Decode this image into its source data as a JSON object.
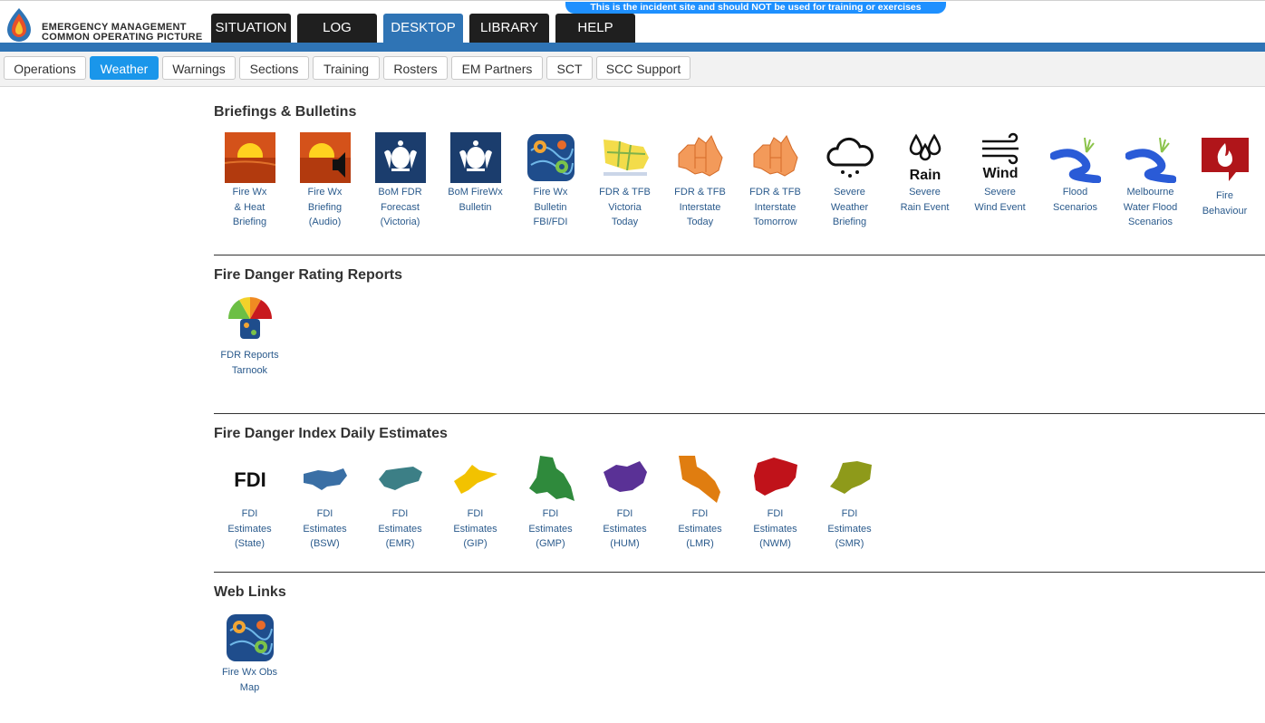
{
  "header": {
    "logo_line1": "EMERGENCY MANAGEMENT",
    "logo_line2": "COMMON OPERATING PICTURE",
    "banner": "This is the incident site and should NOT be used for training or exercises",
    "tabs": [
      {
        "label": "SITUATION"
      },
      {
        "label": "LOG"
      },
      {
        "label": "DESKTOP"
      },
      {
        "label": "LIBRARY"
      },
      {
        "label": "HELP"
      }
    ],
    "active_tab": "DESKTOP"
  },
  "subnav": {
    "items": [
      {
        "label": "Operations"
      },
      {
        "label": "Weather"
      },
      {
        "label": "Warnings"
      },
      {
        "label": "Sections"
      },
      {
        "label": "Training"
      },
      {
        "label": "Rosters"
      },
      {
        "label": "EM Partners"
      },
      {
        "label": "SCT"
      },
      {
        "label": "SCC Support"
      }
    ],
    "active": "Weather"
  },
  "sections": [
    {
      "title": "Briefings & Bulletins",
      "tiles": [
        {
          "icon": "sunset-icon",
          "lines": [
            "Fire Wx",
            "& Heat",
            "Briefing"
          ]
        },
        {
          "icon": "sunset-audio-icon",
          "lines": [
            "Fire Wx",
            "Briefing",
            "(Audio)"
          ]
        },
        {
          "icon": "coat-of-arms-icon",
          "lines": [
            "BoM FDR",
            "Forecast",
            "(Victoria)"
          ]
        },
        {
          "icon": "coat-of-arms-icon",
          "lines": [
            "BoM FireWx",
            "Bulletin"
          ]
        },
        {
          "icon": "aboriginal-art-icon",
          "lines": [
            "Fire Wx",
            "Bulletin",
            "FBI/FDI"
          ]
        },
        {
          "icon": "victoria-map-icon",
          "lines": [
            "FDR & TFB",
            "Victoria",
            "Today"
          ]
        },
        {
          "icon": "australia-map-icon",
          "lines": [
            "FDR & TFB",
            "Interstate",
            "Today"
          ]
        },
        {
          "icon": "australia-map-icon",
          "lines": [
            "FDR & TFB",
            "Interstate",
            "Tomorrow"
          ]
        },
        {
          "icon": "cloud-icon",
          "lines": [
            "Severe",
            "Weather",
            "Briefing"
          ]
        },
        {
          "icon": "rain-icon",
          "lines": [
            "Severe",
            "Rain Event"
          ],
          "icon_text": "Rain"
        },
        {
          "icon": "wind-icon",
          "lines": [
            "Severe",
            "Wind Event"
          ],
          "icon_text": "Wind"
        },
        {
          "icon": "river-icon",
          "lines": [
            "Flood",
            "Scenarios"
          ]
        },
        {
          "icon": "river-icon",
          "lines": [
            "Melbourne",
            "Water Flood",
            "Scenarios"
          ]
        },
        {
          "icon": "fire-icon",
          "lines": [
            "Fire",
            "Behaviour"
          ]
        }
      ]
    },
    {
      "title": "Fire Danger Rating Reports",
      "tiles": [
        {
          "icon": "fdr-gauge-icon",
          "lines": [
            "FDR Reports",
            "Tarnook"
          ]
        }
      ]
    },
    {
      "title": "Fire Danger Index Daily Estimates",
      "tiles": [
        {
          "icon": "fdi-text-icon",
          "lines": [
            "FDI",
            "Estimates",
            "(State)"
          ],
          "icon_text": "FDI"
        },
        {
          "icon": "region-map-icon",
          "lines": [
            "FDI",
            "Estimates",
            "(BSW)"
          ],
          "color": "#3a6fa5"
        },
        {
          "icon": "region-map-icon",
          "lines": [
            "FDI",
            "Estimates",
            "(EMR)"
          ],
          "color": "#3c7f86"
        },
        {
          "icon": "region-map-icon",
          "lines": [
            "FDI",
            "Estimates",
            "(GIP)"
          ],
          "color": "#f2c200"
        },
        {
          "icon": "region-map-icon",
          "lines": [
            "FDI",
            "Estimates",
            "(GMP)"
          ],
          "color": "#2f8a3c"
        },
        {
          "icon": "region-map-icon",
          "lines": [
            "FDI",
            "Estimates",
            "(HUM)"
          ],
          "color": "#5a3196"
        },
        {
          "icon": "region-map-icon",
          "lines": [
            "FDI",
            "Estimates",
            "(LMR)"
          ],
          "color": "#e07d10"
        },
        {
          "icon": "region-map-icon",
          "lines": [
            "FDI",
            "Estimates",
            "(NWM)"
          ],
          "color": "#c0121a"
        },
        {
          "icon": "region-map-icon",
          "lines": [
            "FDI",
            "Estimates",
            "(SMR)"
          ],
          "color": "#8e9a1a"
        }
      ]
    },
    {
      "title": "Web Links",
      "tiles": [
        {
          "icon": "aboriginal-art-icon",
          "lines": [
            "Fire Wx Obs",
            "Map"
          ]
        }
      ]
    }
  ]
}
